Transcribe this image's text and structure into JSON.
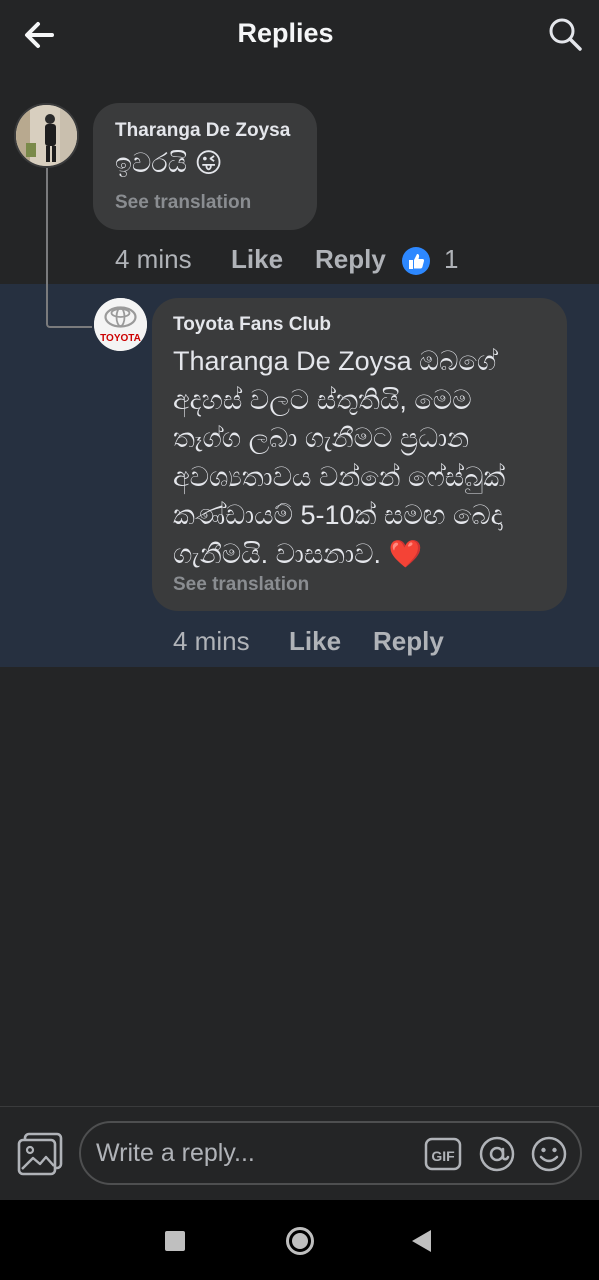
{
  "header": {
    "title": "Replies"
  },
  "comments": [
    {
      "author": "Tharanga De Zoysa",
      "text": "ඉවරයි 😜",
      "see_translation": "See translation",
      "time": "4 mins",
      "like_label": "Like",
      "reply_label": "Reply",
      "reaction_count": "1",
      "avatar_icon": "user-photo"
    },
    {
      "author": "Toyota Fans Club",
      "text_lines": [
        "Tharanga De Zoysa ඔබගේ",
        "අදහස් වලට ස්තුතියි, මෙම",
        "තෑග්ග ලබා ගැනීමට ප්‍රධාන",
        "අවශ්‍යතාවය වන්නේ ෆේස්බුක්",
        "කණ්ඩායම් 5-10ක් සමඟ බෙදා",
        "ගැනීමයි. වාසනාව. ❤️"
      ],
      "see_translation": "See translation",
      "time": "4 mins",
      "like_label": "Like",
      "reply_label": "Reply",
      "avatar_text": "TOYOTA"
    }
  ],
  "composer": {
    "placeholder": "Write a reply..."
  },
  "colors": {
    "background": "#242526",
    "bubble": "#3a3b3c",
    "highlight": "#263040",
    "like_blue": "#2d88ff"
  }
}
